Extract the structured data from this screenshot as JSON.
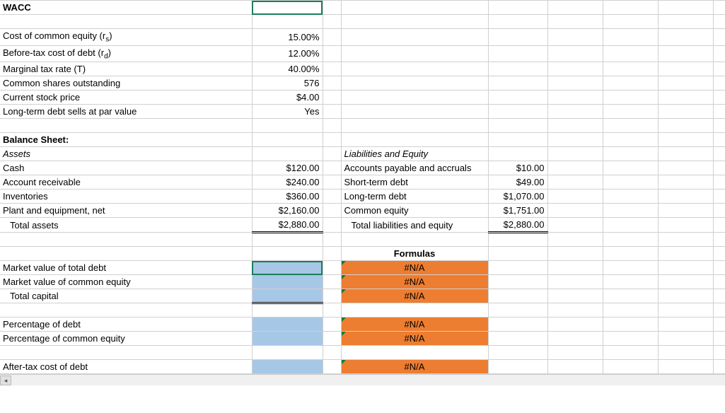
{
  "title": "WACC",
  "inputs": {
    "cost_common_equity_label": "Cost of common equity (r",
    "cost_common_equity_sub": "s",
    "cost_common_equity_val": "15.00%",
    "beforetax_debt_label": "Before-tax cost of debt (r",
    "beforetax_debt_sub": "d",
    "beforetax_debt_val": "12.00%",
    "marginal_tax_label": "Marginal tax rate (T)",
    "marginal_tax_val": "40.00%",
    "shares_label": "Common shares outstanding",
    "shares_val": "576",
    "price_label": "Current stock price",
    "price_val": "$4.00",
    "ltd_par_label": "Long-term debt sells at par value",
    "ltd_par_val": "Yes"
  },
  "balance": {
    "header": "Balance Sheet:",
    "assets_header": "Assets",
    "liab_header": "Liabilities and Equity",
    "cash_label": "Cash",
    "cash_val": "$120.00",
    "ap_label": "Accounts payable and accruals",
    "ap_val": "$10.00",
    "ar_label": "Account receivable",
    "ar_val": "$240.00",
    "std_label": "Short-term debt",
    "std_val": "$49.00",
    "inv_label": "Inventories",
    "inv_val": "$360.00",
    "ltd_label": "Long-term debt",
    "ltd_val": "$1,070.00",
    "pne_label": "Plant and equipment, net",
    "pne_val": "$2,160.00",
    "ce_label": "Common equity",
    "ce_val": "$1,751.00",
    "ta_label": "  Total assets",
    "ta_val": "$2,880.00",
    "tle_label": "  Total liabilities and equity",
    "tle_val": "$2,880.00"
  },
  "calc": {
    "formulas_header": "Formulas",
    "mv_debt_label": "Market value of total debt",
    "mv_equity_label": "Market value of common equity",
    "total_cap_label": "  Total capital",
    "pct_debt_label": "Percentage of debt",
    "pct_equity_label": "Percentage of common equity",
    "at_cost_debt_label": "After-tax cost of debt",
    "na": "#N/A"
  }
}
